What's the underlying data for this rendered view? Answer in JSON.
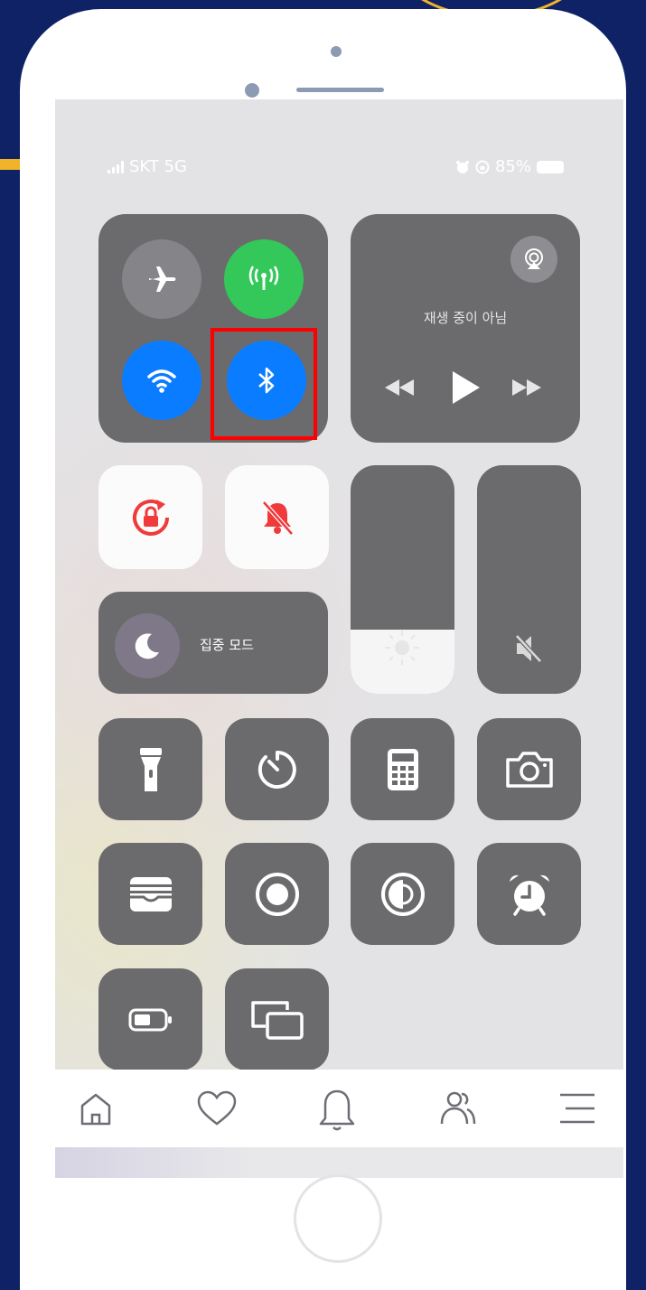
{
  "status_bar": {
    "carrier": "SKT 5G",
    "battery": "85%"
  },
  "media": {
    "now_playing": "재생 중이 아님"
  },
  "focus": {
    "label": "집중 모드"
  },
  "brightness_level": 0.28,
  "volume_level": 0.0,
  "colors": {
    "tile": "#6b6b6d",
    "accent_blue": "#0a7cff",
    "accent_green": "#34c759",
    "highlight": "#ff0000",
    "device_bg": "#0f2266"
  },
  "nav": [
    "home-icon",
    "heart-icon",
    "bell-icon",
    "people-icon",
    "menu-icon"
  ]
}
